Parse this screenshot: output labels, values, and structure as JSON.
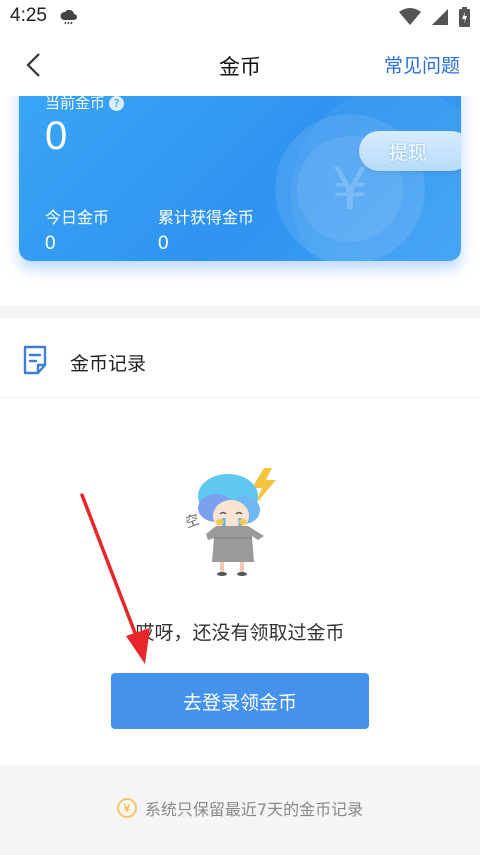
{
  "status_bar": {
    "time": "4:25"
  },
  "nav": {
    "title": "金币",
    "faq_label": "常见问题"
  },
  "balance_card": {
    "current_label": "当前金币",
    "current_value": "0",
    "withdraw_label": "提现",
    "today_label": "今日金币",
    "today_value": "0",
    "total_label": "累计获得金币",
    "total_value": "0",
    "coin_symbol": "¥"
  },
  "records": {
    "title": "金币记录",
    "empty_text": "哎呀，还没有领取过金币",
    "empty_illustration_text": "空",
    "login_button": "去登录领金币"
  },
  "footer": {
    "note": "系统只保留最近7天的金币记录",
    "coin_symbol": "¥"
  },
  "colors": {
    "accent": "#4592ec",
    "card": "#2f93f0",
    "annotation_arrow": "#e8262a"
  }
}
